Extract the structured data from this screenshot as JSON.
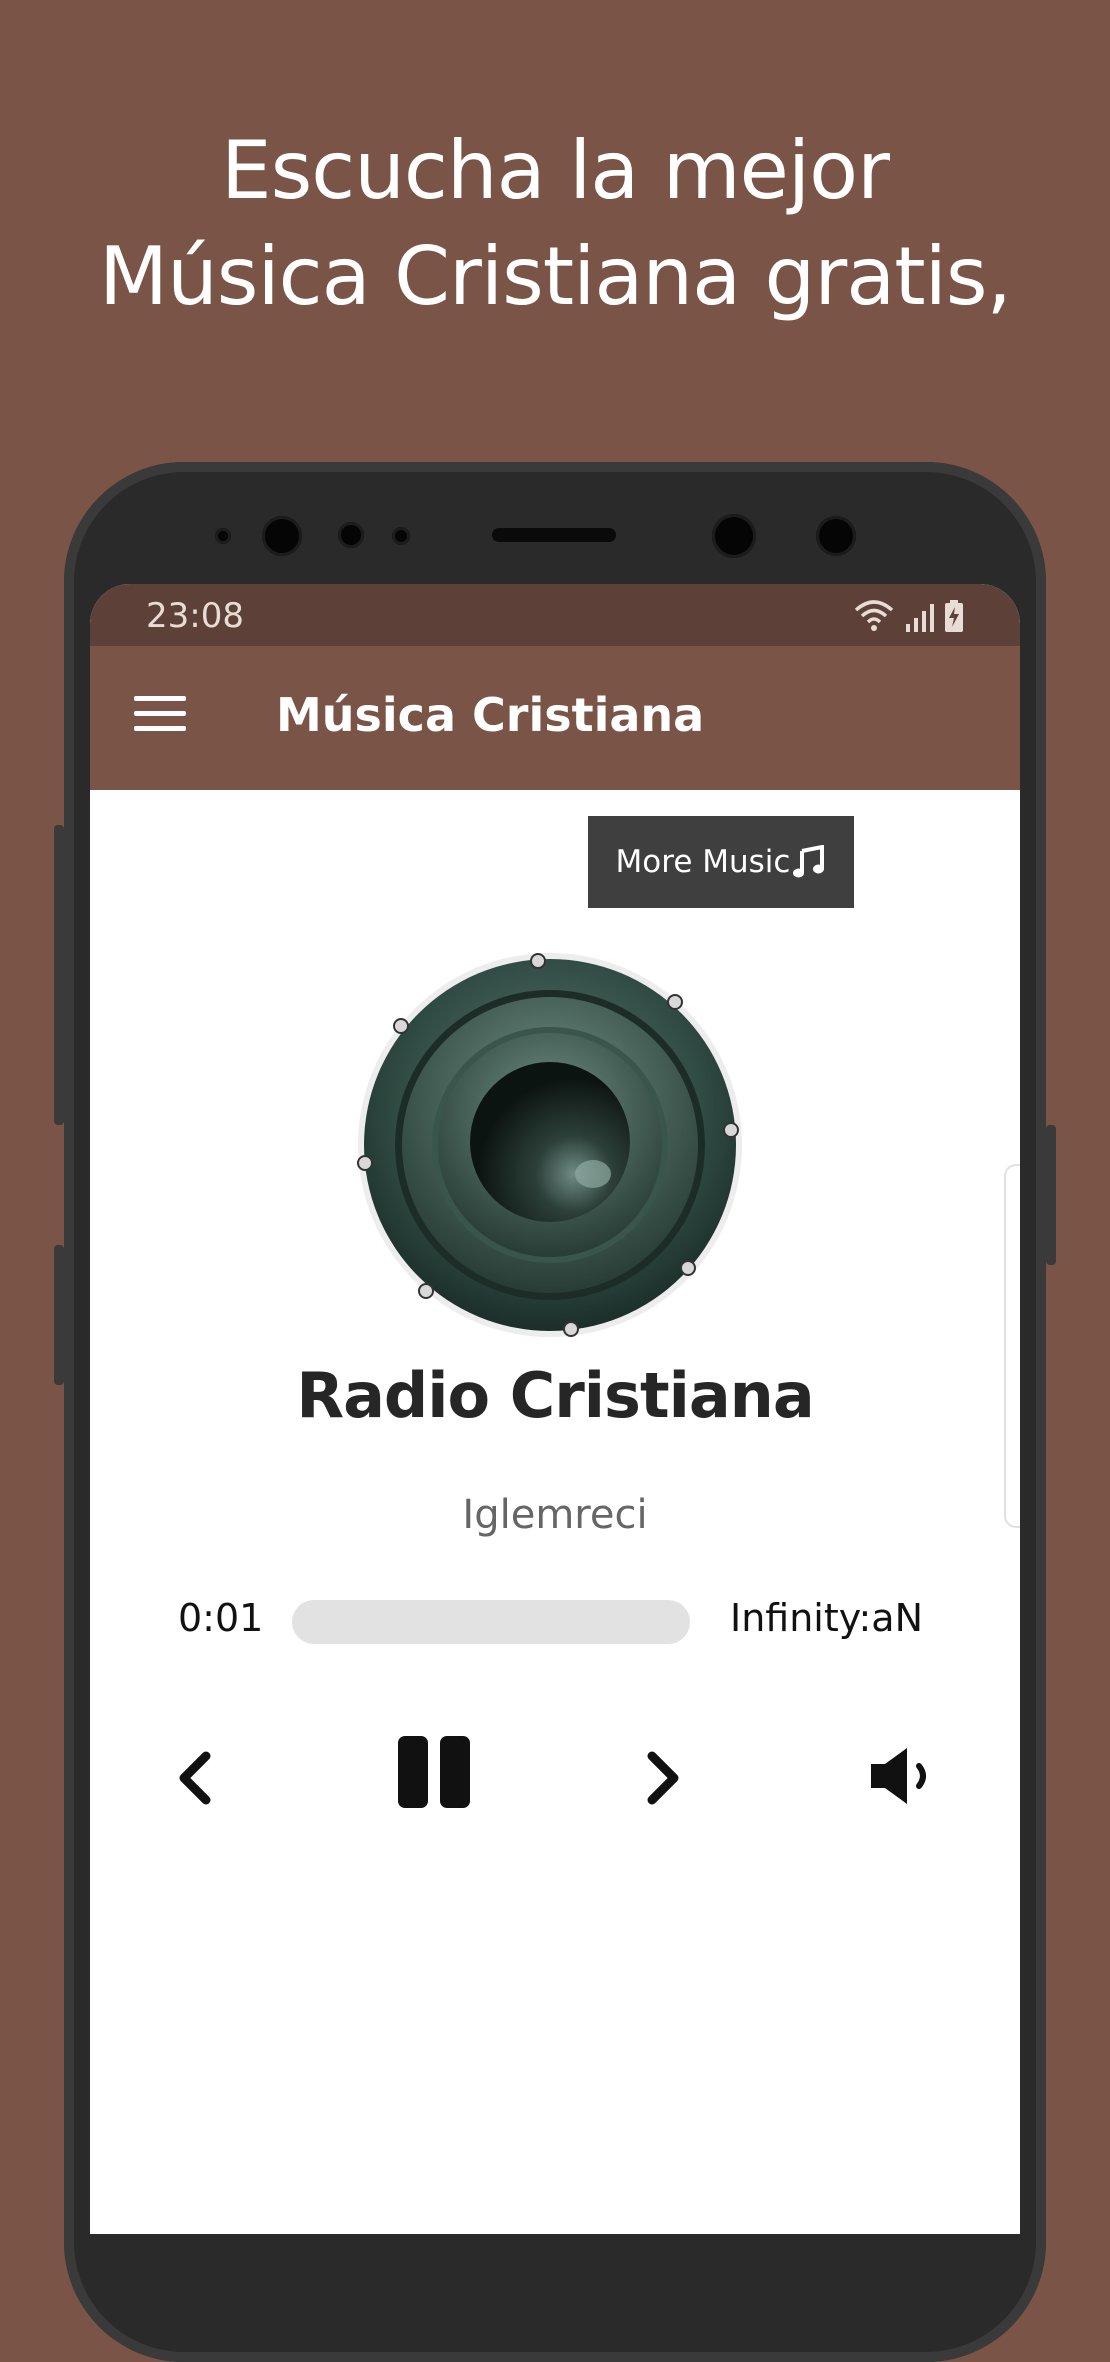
{
  "promo": {
    "line1": "Escucha la mejor",
    "line2": "Música Cristiana gratis,"
  },
  "statusbar": {
    "time": "23:08"
  },
  "appbar": {
    "title": "Música Cristiana",
    "menu_icon": "hamburger-menu-icon"
  },
  "more_button": {
    "label": "More Music",
    "icon": "music-note-icon"
  },
  "player": {
    "station": "Radio Cristiana",
    "artist": "Iglemreci",
    "current_time": "0:01",
    "total_time": "Infinity:aN",
    "progress": 0,
    "controls": [
      "previous-icon",
      "pause-icon",
      "next-icon",
      "volume-icon"
    ]
  },
  "colors": {
    "background": "#7a5446",
    "appbar": "#7a5446",
    "statusbar": "#5d4037",
    "button": "#3f3f3f"
  }
}
